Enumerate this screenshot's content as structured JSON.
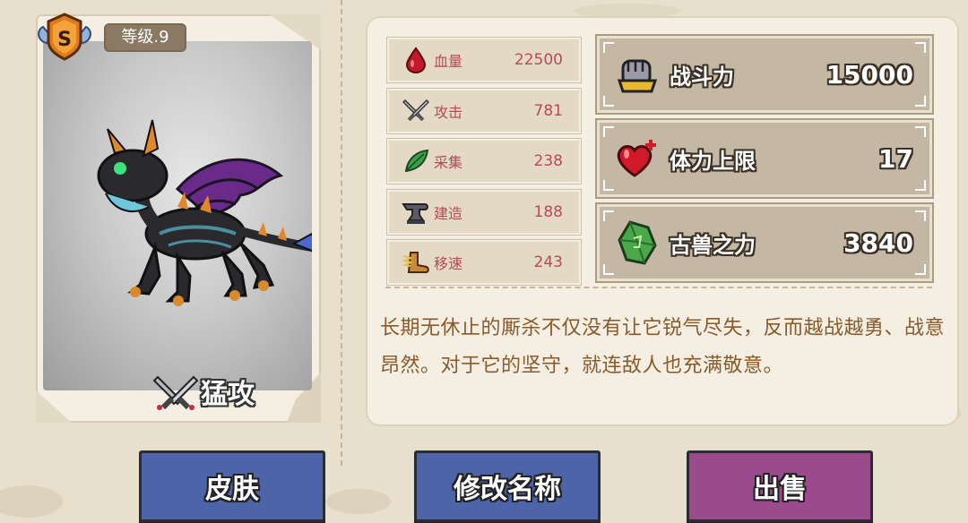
{
  "character": {
    "level_text": "等级.9",
    "rank": "S",
    "skill_label": "猛攻"
  },
  "attributes": [
    {
      "icon": "blood-drop-icon",
      "name": "血量",
      "value": "22500"
    },
    {
      "icon": "crossed-swords-icon",
      "name": "攻击",
      "value": "781"
    },
    {
      "icon": "leaf-icon",
      "name": "采集",
      "value": "238"
    },
    {
      "icon": "anvil-icon",
      "name": "建造",
      "value": "188"
    },
    {
      "icon": "winged-boot-icon",
      "name": "移速",
      "value": "243"
    }
  ],
  "power_stats": [
    {
      "icon": "fist-icon",
      "name": "战斗力",
      "value": "15000"
    },
    {
      "icon": "heart-icon",
      "name": "体力上限",
      "value": "17"
    },
    {
      "icon": "green-crystal-icon",
      "name": "古兽之力",
      "value": "3840"
    }
  ],
  "description": "长期无休止的厮杀不仅没有让它锐气尽失，反而越战越勇、战意昂然。对于它的坚守，就连敌人也充满敬意。",
  "buttons": {
    "skin": "皮肤",
    "rename": "修改名称",
    "sell": "出售"
  },
  "colors": {
    "stat_text": "#b94a55",
    "desc_text": "#8a5a2a",
    "btn_blue": "#4e64a8",
    "btn_purple": "#9c4a8e"
  }
}
